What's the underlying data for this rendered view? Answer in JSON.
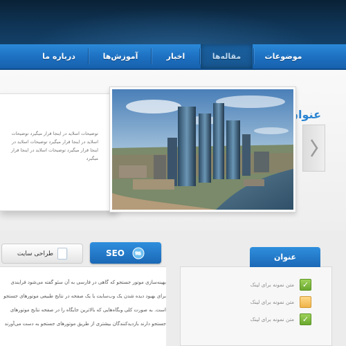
{
  "nav": {
    "items": [
      {
        "label": "موضوعات"
      },
      {
        "label": "مقاله‌ها"
      },
      {
        "label": "اخبار"
      },
      {
        "label": "آموزش‌ها"
      },
      {
        "label": "درباره ما"
      }
    ]
  },
  "slider": {
    "title": "عنوان اسلاید",
    "text": "توضیحات اسلاید در اینجا قرار میگیرد توضیحات اسلاید در اینجا قرار میگیرد توضیحات اسلاید در اینجا قرار میگیرد توضیحات اسلاید در اینجا قرار میگیرد"
  },
  "tabs": {
    "seo_label": "SEO",
    "design_label": "طراحی سایت"
  },
  "content": {
    "text": "بهینه‌سازی موتور جستجو که گاهی در فارسی به آن سئو گفته می‌شود فرایندی برای بهبود دیده شدن یک وب‌سایت یا یک صفحه در نتایج طبیعی موتورهای جستجو است. به صورت کلی وبگاه‌هایی که بالاترین جایگاه را در صفحه نتایج موتورهای جستجو دارند بازدیدکنندگان بیشتری از طریق موتورهای جستجو به دست می‌آورند"
  },
  "sidebox": {
    "title": "عنوان",
    "links": [
      {
        "label": "متن نمونه برای لینک",
        "icon": "check-icon"
      },
      {
        "label": "متن نمونه برای لینک",
        "icon": "folder-icon"
      },
      {
        "label": "متن نمونه برای لینک",
        "icon": "check-icon"
      }
    ]
  },
  "colors": {
    "nav_blue": "#1d6fc0",
    "header_dark": "#0f3455",
    "accent_blue": "#2a84d2",
    "check_green": "#6aa82f"
  }
}
